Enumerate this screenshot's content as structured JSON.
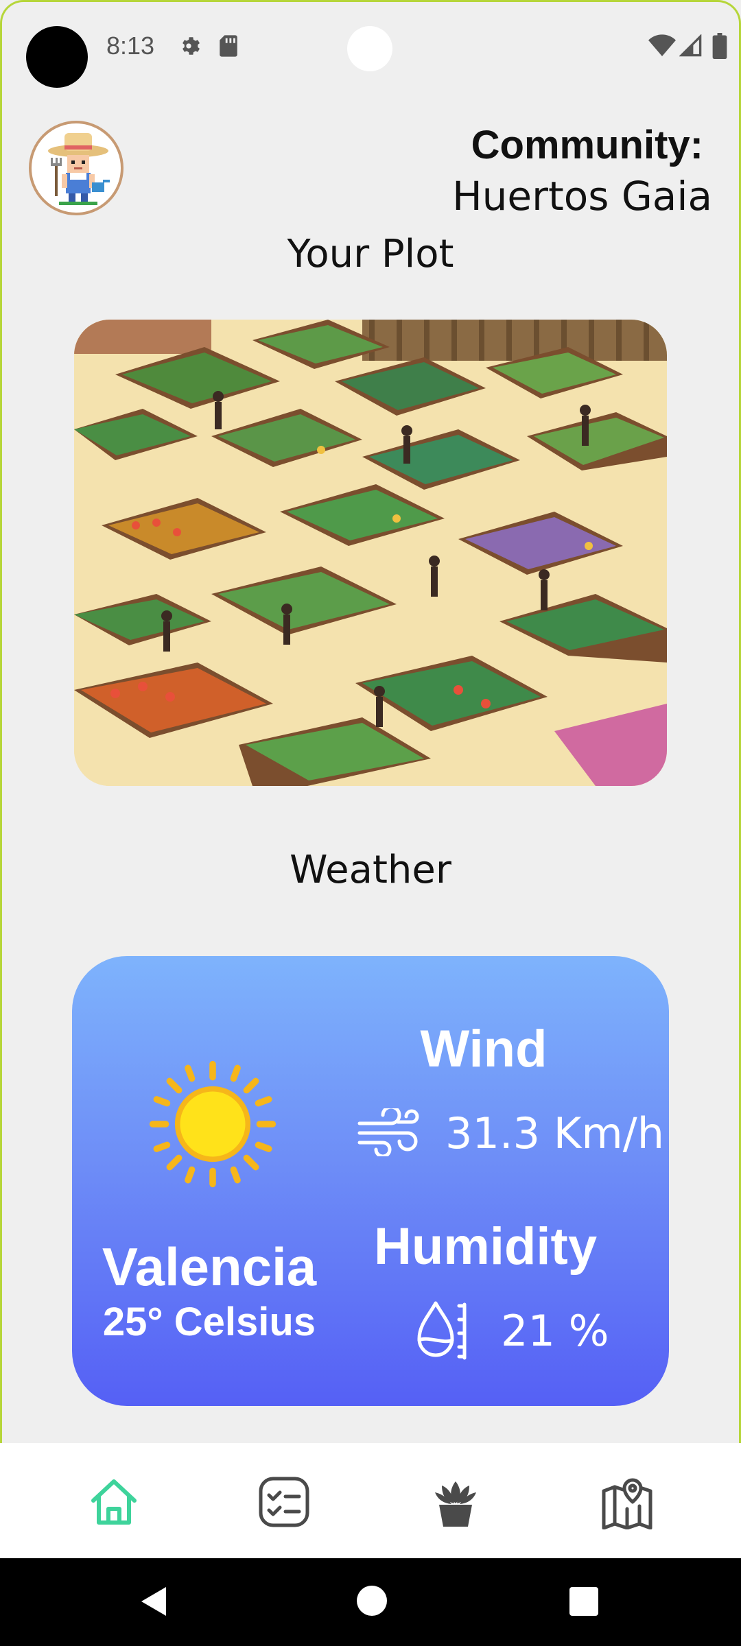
{
  "status_bar": {
    "time": "8:13",
    "icons": [
      "camera-dot",
      "gear-icon",
      "sd-card-icon",
      "wifi-icon",
      "signal-icon",
      "battery-icon"
    ]
  },
  "header": {
    "avatar_icon": "farmer-avatar",
    "community_label": "Community:",
    "community_name": "Huertos Gaia"
  },
  "plot": {
    "title": "Your Plot",
    "image": "community-garden-illustration"
  },
  "weather": {
    "title": "Weather",
    "city": "Valencia",
    "temperature": "25° Celsius",
    "wind_label": "Wind",
    "wind_value": "31.3 Km/h",
    "humidity_label": "Humidity",
    "humidity_value": "21 %",
    "icons": {
      "condition": "sun-icon",
      "wind": "wind-icon",
      "humidity": "humidity-drop-icon"
    },
    "colors": {
      "gradient_top": "#7eb3fc",
      "gradient_bottom": "#5560f5"
    }
  },
  "bottom_nav": {
    "items": [
      {
        "icon": "home-icon",
        "active": true
      },
      {
        "icon": "checklist-icon",
        "active": false
      },
      {
        "icon": "plant-pot-icon",
        "active": false
      },
      {
        "icon": "map-icon",
        "active": false
      }
    ],
    "active_color": "#3ed39b",
    "inactive_color": "#4a4a4a"
  },
  "system_nav": {
    "icons": [
      "back-icon",
      "home-circle-icon",
      "recents-icon"
    ]
  }
}
